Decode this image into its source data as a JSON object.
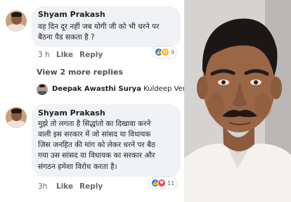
{
  "comment1": {
    "author": "Shyam Prakash",
    "lines": [
      "वह दिन दूर नहीं जब योगी जी को भी धरने पर",
      "बैठना पैड सकता है ?"
    ],
    "time": "3 h",
    "like_label": "Like",
    "reply_label": "Reply",
    "reaction_count": "9"
  },
  "view_replies_label": "View 2 more replies",
  "reply_preview": {
    "author": "Deepak Awasthi Surya",
    "text": "Kuldeep Verma..."
  },
  "comment2": {
    "author": "Shyam Prakash",
    "lines": [
      "मुझे तो लगता है सिद्धांतो का दिखावा करने",
      "वाली इस सरकार में जो सांसद या विधायक",
      "जिस जनहित की  मांग को लेकर धरने पर बैठ",
      "गया उस सांसद या विधायक का सरकार और",
      "संगठन हमेशा विरोध करता है।"
    ],
    "time": "3h",
    "like_label": "Like",
    "reply_label": "Reply",
    "reaction_count": "11"
  },
  "colors": {
    "bubble": "#f0f2f5",
    "like_blue": "#1877f2",
    "love_red": "#f33e58",
    "haha_yellow": "#f7b125",
    "meta_grey": "#65676b"
  }
}
